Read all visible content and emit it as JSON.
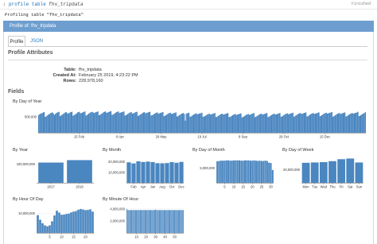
{
  "cell": {
    "line_number": "1",
    "command_keyword": "profile table",
    "command_arg": "fhv_tripdata",
    "kernel_label": "Finished",
    "output_message": "Profiling table \"fhv_tripdata\""
  },
  "panel": {
    "title": "Profile of: fhv_tripdata"
  },
  "tabs": [
    {
      "label": "Profile"
    },
    {
      "label": "JSON"
    }
  ],
  "profile_attributes": {
    "heading": "Profile Attributes",
    "rows": [
      {
        "key": "Table:",
        "value": "fhv_tripdata"
      },
      {
        "key": "Created At:",
        "value": "February 25 2019, 4:23:22 PM"
      },
      {
        "key": "Rows:",
        "value": "228,978,160"
      }
    ]
  },
  "fields": {
    "heading": "Fields"
  },
  "chart_data": [
    {
      "title": "By Day of Year",
      "type": "bar",
      "x_tick_labels": [
        "15 Feb",
        "8 Apr",
        "29 May",
        "19 Jul",
        "8 Sep",
        "29 Oct",
        "15 Dec"
      ],
      "y_tick_labels": [
        "500,000"
      ],
      "ylim": [
        0,
        800000
      ],
      "bar_color": "#4a86c0",
      "values": [
        560000,
        580000,
        600000,
        610000,
        620000,
        640000,
        650000,
        500000,
        510000,
        540000,
        560000,
        580000,
        590000,
        620000,
        630000,
        640000,
        600000,
        560000,
        590000,
        620000,
        630000,
        650000,
        660000,
        520000,
        540000,
        560000,
        580000,
        600000,
        630000,
        640000,
        650000,
        600000,
        610000,
        620000,
        640000,
        650000,
        660000,
        530000,
        550000,
        570000,
        590000,
        610000,
        640000,
        650000,
        660000,
        610000,
        620000,
        630000,
        650000,
        660000,
        670000,
        540000,
        550000,
        580000,
        600000,
        620000,
        640000,
        650000,
        660000,
        630000,
        620000,
        640000,
        650000,
        660000,
        670000,
        550000,
        560000,
        580000,
        600000,
        620000,
        650000,
        660000,
        670000,
        630000,
        630000,
        650000,
        660000,
        670000,
        680000,
        560000,
        570000,
        590000,
        610000,
        630000,
        650000,
        660000,
        670000,
        620000,
        630000,
        640000,
        650000,
        660000,
        670000,
        540000,
        550000,
        570000,
        590000,
        610000,
        630000,
        640000,
        650000,
        600000,
        610000,
        620000,
        640000,
        650000,
        660000,
        530000,
        540000,
        560000,
        580000,
        600000,
        620000,
        640000,
        650000,
        610000,
        620000,
        630000,
        640000,
        650000,
        660000,
        540000,
        550000,
        560000,
        580000,
        600000,
        620000,
        630000,
        640000,
        600000,
        610000,
        620000,
        630000,
        640000,
        650000,
        520000,
        530000,
        550000,
        570000,
        590000,
        610000,
        620000,
        630000,
        590000,
        600000,
        610000,
        620000,
        630000,
        640000,
        510000,
        520000,
        540000,
        560000,
        580000,
        600000,
        610000,
        620000,
        590000,
        380000,
        600000,
        610000,
        620000,
        630000,
        500000,
        510000,
        530000,
        550000,
        570000,
        590000,
        600000,
        610000,
        580000,
        590000,
        600000,
        610000,
        620000,
        630000,
        500000,
        510000,
        520000,
        540000,
        560000,
        580000,
        590000,
        600000,
        570000,
        580000,
        590000,
        600000,
        610000,
        620000,
        490000,
        500000,
        520000,
        540000,
        560000,
        580000,
        590000,
        600000,
        570000,
        580000,
        590000,
        600000,
        610000,
        620000,
        490000,
        500000,
        510000,
        530000,
        550000,
        570000,
        580000,
        590000,
        560000,
        570000,
        580000,
        590000,
        600000,
        610000,
        480000,
        490000,
        510000,
        530000,
        550000,
        570000,
        580000,
        590000,
        560000,
        570000,
        580000,
        600000,
        610000,
        620000,
        490000,
        500000,
        520000,
        540000,
        560000,
        580000,
        590000,
        600000,
        570000,
        580000,
        590000,
        600000,
        610000,
        620000,
        490000,
        500000,
        520000,
        540000,
        560000,
        580000,
        590000,
        600000,
        570000,
        580000,
        590000,
        600000,
        610000,
        620000,
        500000,
        510000,
        530000,
        550000,
        570000,
        590000,
        600000,
        610000,
        580000,
        590000,
        600000,
        610000,
        620000,
        630000,
        500000,
        520000,
        540000,
        560000,
        580000,
        600000,
        610000,
        620000,
        590000,
        600000,
        610000,
        620000,
        630000,
        640000,
        510000,
        520000,
        540000,
        560000,
        580000,
        600000,
        610000,
        620000,
        590000,
        600000,
        610000,
        620000,
        630000,
        640000,
        520000,
        530000,
        550000,
        570000,
        590000,
        610000,
        620000,
        630000,
        600000,
        610000,
        620000,
        630000,
        640000,
        650000,
        500000,
        520000,
        540000,
        560000,
        580000,
        600000,
        610000,
        620000,
        590000,
        600000,
        610000,
        620000,
        630000,
        640000,
        510000,
        520000,
        540000,
        560000,
        580000,
        600000,
        610000,
        620000,
        600000,
        610000,
        620000,
        630000,
        640000,
        660000,
        520000,
        530000,
        550000,
        570000,
        590000,
        610000,
        620000,
        650000
      ]
    },
    {
      "title": "By Year",
      "type": "bar",
      "categories": [
        "2017",
        "2018"
      ],
      "values": [
        108000000,
        121000000
      ],
      "y_tick_labels": [
        "100,000,000"
      ],
      "ylim": [
        0,
        140000000
      ],
      "bar_color": "#4a86c0"
    },
    {
      "title": "By Month",
      "type": "bar",
      "categories": [
        "Jan",
        "Feb",
        "Mar",
        "Apr",
        "May",
        "Jun",
        "Jul",
        "Aug",
        "Sep",
        "Oct",
        "Nov",
        "Dec"
      ],
      "x_tick_labels": [
        "Feb",
        "Apr",
        "Jun",
        "Aug",
        "Oct",
        "Dec"
      ],
      "values": [
        19500000,
        18500000,
        20500000,
        19800000,
        20200000,
        19700000,
        18700000,
        18600000,
        18800000,
        19700000,
        19100000,
        19900000
      ],
      "y_tick_labels": [
        "10,000,000",
        "20,000,000"
      ],
      "ylim": [
        0,
        25000000
      ],
      "bar_color": "#4a86c0"
    },
    {
      "title": "By Day of Month",
      "type": "bar",
      "categories": [
        "1",
        "2",
        "3",
        "4",
        "5",
        "6",
        "7",
        "8",
        "9",
        "10",
        "11",
        "12",
        "13",
        "14",
        "15",
        "16",
        "17",
        "18",
        "19",
        "20",
        "21",
        "22",
        "23",
        "24",
        "25",
        "26",
        "27",
        "28",
        "29",
        "30",
        "31"
      ],
      "x_tick_labels": [
        "5",
        "10",
        "15",
        "20",
        "25",
        "30"
      ],
      "values": [
        7400000,
        7500000,
        7600000,
        7600000,
        7600000,
        7700000,
        7700000,
        7600000,
        7600000,
        7700000,
        7700000,
        7700000,
        7700000,
        7600000,
        7600000,
        7700000,
        7700000,
        7700000,
        7600000,
        7600000,
        7700000,
        7600000,
        7500000,
        7600000,
        7500000,
        7500000,
        7600000,
        7500000,
        6900000,
        6800000,
        4400000
      ],
      "y_tick_labels": [
        "5,000,000"
      ],
      "ylim": [
        0,
        9000000
      ],
      "bar_color": "#4a86c0"
    },
    {
      "title": "By Day of Week",
      "type": "bar",
      "categories": [
        "Mon",
        "Tue",
        "Wed",
        "Thu",
        "Fri",
        "Sat",
        "Sun"
      ],
      "values": [
        30500000,
        31000000,
        31500000,
        33000000,
        36000000,
        37000000,
        31000000
      ],
      "y_tick_labels": [
        "20,000,000"
      ],
      "ylim": [
        0,
        40000000
      ],
      "bar_color": "#4a86c0"
    },
    {
      "title": "By Hour Of Day",
      "type": "bar",
      "categories": [
        "0",
        "1",
        "2",
        "3",
        "4",
        "5",
        "6",
        "7",
        "8",
        "9",
        "10",
        "11",
        "12",
        "13",
        "14",
        "15",
        "16",
        "17",
        "18",
        "19",
        "20",
        "21",
        "22",
        "23"
      ],
      "x_tick_labels": [
        "5",
        "10",
        "15",
        "20"
      ],
      "values": [
        9200000,
        6800000,
        5000000,
        3900000,
        3400000,
        3900000,
        6000000,
        9000000,
        11500000,
        10500000,
        9400000,
        9500000,
        9800000,
        10000000,
        10600000,
        11000000,
        11300000,
        12000000,
        12400000,
        12100000,
        11800000,
        11900000,
        12200000,
        11000000
      ],
      "y_tick_labels": [
        "10,000,000"
      ],
      "ylim": [
        0,
        14000000
      ],
      "bar_color": "#4a86c0"
    },
    {
      "title": "By Minute Of Hour",
      "type": "bar",
      "x_tick_labels": [
        "10",
        "20",
        "30",
        "40",
        "50"
      ],
      "values": [
        4000000,
        3800000,
        3800000,
        3800000,
        3800000,
        3800000,
        3800000,
        3800000,
        3800000,
        3800000,
        3800000,
        3800000,
        3800000,
        3800000,
        3800000,
        3800000,
        3800000,
        3800000,
        3800000,
        3800000,
        3800000,
        3800000,
        3800000,
        3800000,
        3800000,
        3800000,
        3800000,
        3800000,
        3800000,
        3800000,
        3900000,
        3800000,
        3800000,
        3800000,
        3800000,
        3800000,
        3800000,
        3800000,
        3800000,
        3800000,
        3800000,
        3800000,
        3800000,
        3800000,
        3800000,
        3800000,
        3800000,
        3800000,
        3800000,
        3800000,
        3800000,
        3800000,
        3800000,
        3800000,
        3800000,
        3800000,
        3800000,
        3800000,
        3800000,
        3800000
      ],
      "y_tick_labels": [
        "2,000,000",
        "4,000,000"
      ],
      "ylim": [
        0,
        4500000
      ],
      "bar_color": "#4a86c0"
    }
  ]
}
